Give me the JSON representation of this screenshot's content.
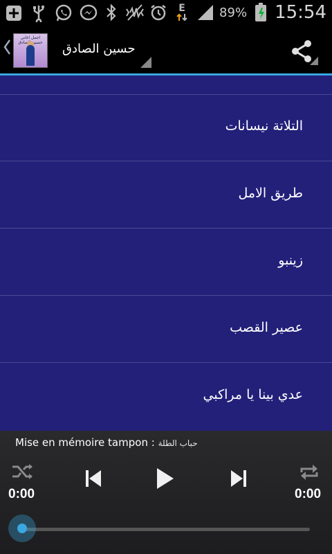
{
  "status_bar": {
    "battery": "89%",
    "time": "15:54",
    "network_letter": "E",
    "icons": [
      "plus-icon",
      "usb-icon",
      "whatsapp-icon",
      "messenger-icon",
      "bluetooth-icon",
      "vibrate-icon",
      "alarm-icon",
      "data-arrows-icon",
      "signal-icon",
      "battery-icon"
    ]
  },
  "action_bar": {
    "title": "حسين الصادق",
    "logo_text": "اجمل اغاني حسين الصادق",
    "icons": [
      "back-chevron-icon",
      "share-icon"
    ]
  },
  "songs": [
    {
      "label": "التلاتة نيسانات"
    },
    {
      "label": "طريق الامل"
    },
    {
      "label": "زينبو"
    },
    {
      "label": "عصير القصب"
    },
    {
      "label": "عدي بينا يا مراكبي"
    }
  ],
  "player": {
    "buffer_label": "Mise en mémoire tampon :",
    "current_track": "حباب الطلة",
    "elapsed": "0:00",
    "duration": "0:00",
    "progress": 0,
    "icons": [
      "shuffle-icon",
      "previous-icon",
      "play-icon",
      "next-icon",
      "repeat-icon"
    ]
  },
  "colors": {
    "list_bg": "#23207a",
    "accent": "#3aa7e0",
    "player_bg": "#2a2a2c"
  }
}
